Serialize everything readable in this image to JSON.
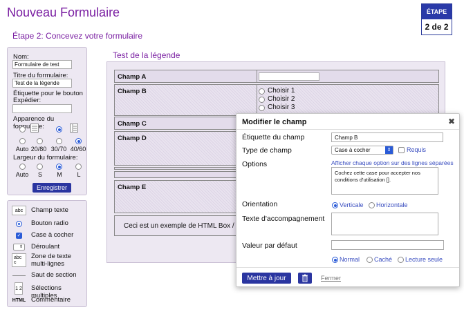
{
  "header": {
    "title": "Nouveau Formulaire",
    "subtitle": "Étape 2: Concevez votre formulaire",
    "step_label": "ÉTAPE",
    "step_value": "2 de 2"
  },
  "settings": {
    "name_label": "Nom:",
    "name_value": "Formulaire de test",
    "form_title_label": "Titre du formulaire:",
    "form_title_value": "Test de la légende",
    "submit_label_line1": "Étiquette pour le bouton",
    "submit_label_line2": "Expédier:",
    "submit_value": "",
    "appearance_label": "Apparence du formulaire:",
    "appearance_options": [
      "Auto",
      "20/80",
      "30/70",
      "40/60"
    ],
    "width_label": "Largeur du formulaire:",
    "width_options": [
      "Auto",
      "S",
      "M",
      "L"
    ],
    "save_button": "Enregistrer"
  },
  "toolbox": {
    "items": [
      {
        "icon": "abc",
        "label": "Champ texte"
      },
      {
        "icon": "radio",
        "label": "Bouton radio"
      },
      {
        "icon": "check",
        "label": "Case à cocher"
      },
      {
        "icon": "select",
        "label": "Déroulant"
      },
      {
        "icon": "abc c",
        "label": "Zone de texte multi-lignes"
      },
      {
        "icon": "line",
        "label": "Saut de section"
      },
      {
        "icon": "1 2",
        "label": "Sélections multiples"
      },
      {
        "icon": "HTML",
        "label": "Commentaire"
      }
    ]
  },
  "canvas": {
    "legend": "Test de la légende",
    "fields": [
      {
        "name": "Champ A"
      },
      {
        "name": "Champ B",
        "choices": [
          "Choisir 1",
          "Choisir 2",
          "Choisir 3"
        ]
      },
      {
        "name": "Champ C"
      },
      {
        "name": "Champ D"
      },
      {
        "name": "Champ E"
      }
    ],
    "html_box_text": "Ceci est un exemple de HTML Box / C"
  },
  "modal": {
    "title": "Modifier le champ",
    "field_label_label": "Étiquette du champ",
    "field_label_value": "Champ B",
    "field_type_label": "Type de champ",
    "field_type_value": "Case à cocher",
    "required_label": "Requis",
    "options_label": "Options",
    "options_link": "Afficher chaque option sur des lignes séparées",
    "options_value": "Cochez cette case pour accepter nos conditions d'utilisation [].",
    "orientation_label": "Orientation",
    "orientation_vertical": "Verticale",
    "orientation_horizontal": "Horizontale",
    "help_text_label": "Texte d'accompagnement",
    "help_text_value": "",
    "default_value_label": "Valeur par défaut",
    "default_value_value": "",
    "visibility_options": [
      "Normal",
      "Caché",
      "Lecture seule"
    ],
    "update_button": "Mettre à jour",
    "close_link": "Fermer"
  }
}
